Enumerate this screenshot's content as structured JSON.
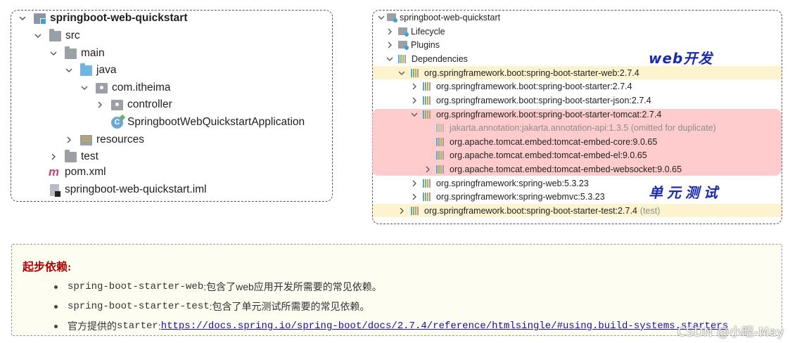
{
  "project_tree": {
    "root": "springboot-web-quickstart",
    "src": "src",
    "main": "main",
    "java": "java",
    "package": "com.itheima",
    "controller": "controller",
    "app_class": "SpringbootWebQuickstartApplication",
    "resources": "resources",
    "test": "test",
    "pom": "pom.xml",
    "iml": "springboot-web-quickstart.iml"
  },
  "maven": {
    "root": "springboot-web-quickstart",
    "lifecycle": "Lifecycle",
    "plugins": "Plugins",
    "dependencies": "Dependencies",
    "starter_web": "org.springframework.boot:spring-boot-starter-web:2.7.4",
    "starter": "org.springframework.boot:spring-boot-starter:2.7.4",
    "starter_json": "org.springframework.boot:spring-boot-starter-json:2.7.4",
    "starter_tomcat": "org.springframework.boot:spring-boot-starter-tomcat:2.7.4",
    "annotation_api": "jakarta.annotation:jakarta.annotation-api:1.3.5 (omitted for duplicate)",
    "tomcat_core": "org.apache.tomcat.embed:tomcat-embed-core:9.0.65",
    "tomcat_el": "org.apache.tomcat.embed:tomcat-embed-el:9.0.65",
    "tomcat_websocket": "org.apache.tomcat.embed:tomcat-embed-websocket:9.0.65",
    "spring_web": "org.springframework:spring-web:5.3.23",
    "spring_webmvc": "org.springframework:spring-webmvc:5.3.23",
    "starter_test": "org.springframework.boot:spring-boot-starter-test:2.7.4",
    "test_scope": "(test)"
  },
  "annotations": {
    "web_dev": "web开发",
    "unit_test": "单元测试"
  },
  "note": {
    "title": "起步依赖:",
    "item1_code": "spring-boot-starter-web",
    "item1_text": ":包含了web应用开发所需要的常见依赖。",
    "item2_code": "spring-boot-starter-test",
    "item2_text": ":包含了单元测试所需要的常见依赖。",
    "item3_prefix": "官方提供的",
    "item3_code": "starter",
    "item3_colon": ":",
    "item3_link": "https://docs.spring.io/spring-boot/docs/2.7.4/reference/htmlsingle/#using.build-systems.starters"
  },
  "watermark": "CSDN @小昭-May",
  "colors": {
    "annotation_blue": "#1a2bb0",
    "note_title_red": "#b00000",
    "highlight_yellow": "#fdf3cf",
    "highlight_pink": "#fdb4b4"
  }
}
